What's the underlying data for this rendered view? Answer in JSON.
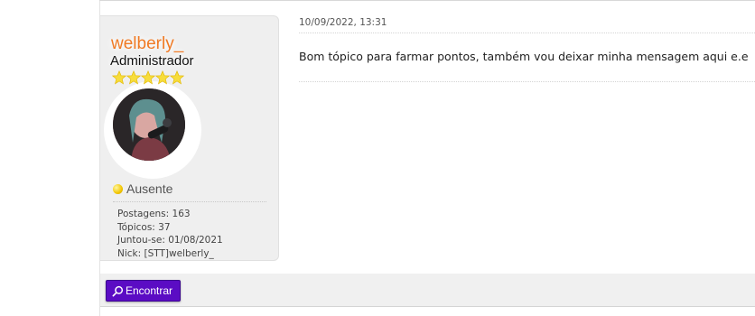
{
  "post": {
    "author": {
      "username": "welberly_",
      "rank": "Administrador",
      "stars": 5,
      "avatar_icon": "user-avatar",
      "status": "Ausente",
      "stats": {
        "posts": "Postagens: 163",
        "topics": "Tópicos: 37",
        "joined": "Juntou-se: 01/08/2021",
        "nick": "Nick: [STT]welberly_"
      }
    },
    "date": "10/09/2022, 13:31",
    "message": "Bom tópico para farmar pontos, também vou deixar minha mensagem aqui e.e"
  },
  "footer": {
    "find_label": "Encontrar",
    "find_icon": "search-icon"
  },
  "colors": {
    "username": "#f07a24",
    "button": "#5b0cc4",
    "star": "#f7dd3c",
    "status_away": "#f2c500"
  }
}
